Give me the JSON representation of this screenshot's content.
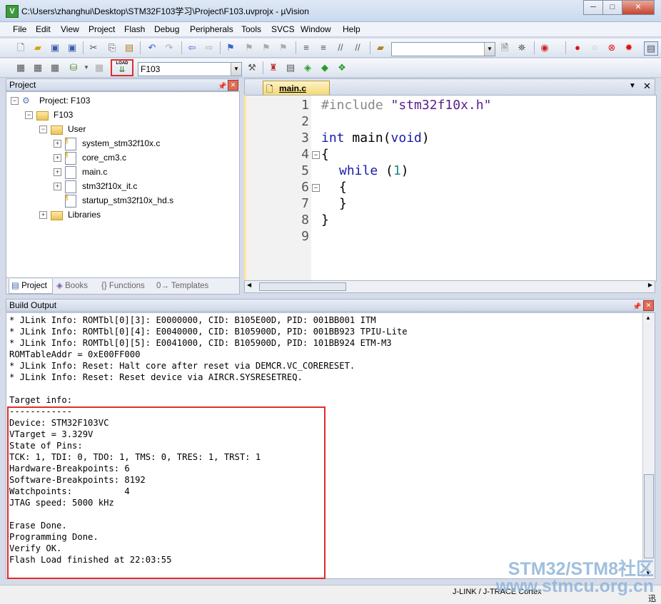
{
  "window": {
    "title": "C:\\Users\\zhanghui\\Desktop\\STM32F103学习\\Project\\F103.uvprojx - µVision",
    "icon_letter": "V",
    "min": "─",
    "max": "□",
    "close": "✕"
  },
  "menu": [
    "File",
    "Edit",
    "View",
    "Project",
    "Flash",
    "Debug",
    "Peripherals",
    "Tools",
    "SVCS",
    "Window",
    "Help"
  ],
  "toolbar2": {
    "load_label": "LOAD",
    "target": "F103"
  },
  "project_panel": {
    "title": "Project",
    "tree": [
      {
        "label": "Project: F103"
      },
      {
        "label": "F103"
      },
      {
        "label": "User"
      },
      {
        "label": "system_stm32f10x.c"
      },
      {
        "label": "core_cm3.c"
      },
      {
        "label": "main.c"
      },
      {
        "label": "stm32f10x_it.c"
      },
      {
        "label": "startup_stm32f10x_hd.s"
      },
      {
        "label": "Libraries"
      }
    ],
    "tabs": [
      "Project",
      "Books",
      "{} Functions",
      "0→ Templates"
    ]
  },
  "editor": {
    "tab": "main.c",
    "line_numbers": [
      "1",
      "2",
      "3",
      "4",
      "5",
      "6",
      "7",
      "8",
      "9"
    ],
    "code": {
      "l1_pre": "#include",
      "l1_str": "\"stm32f10x.h\"",
      "l3_kw": "int",
      "l3_mid": " main(",
      "l3_kw2": "void",
      "l3_end": ")",
      "l4": "{",
      "l5_kw": "while",
      "l5_mid": " (",
      "l5_num": "1",
      "l5_end": ")",
      "l6": "{",
      "l7": "}",
      "l8": "}"
    }
  },
  "build_output": {
    "title": "Build Output",
    "lines": [
      "* JLink Info: ROMTbl[0][3]: E0000000, CID: B105E00D, PID: 001BB001 ITM",
      "* JLink Info: ROMTbl[0][4]: E0040000, CID: B105900D, PID: 001BB923 TPIU-Lite",
      "* JLink Info: ROMTbl[0][5]: E0041000, CID: B105900D, PID: 101BB924 ETM-M3",
      "ROMTableAddr = 0xE00FF000",
      "* JLink Info: Reset: Halt core after reset via DEMCR.VC_CORERESET.",
      "* JLink Info: Reset: Reset device via AIRCR.SYSRESETREQ.",
      "",
      "Target info:",
      "------------",
      "Device: STM32F103VC",
      "VTarget = 3.329V",
      "State of Pins:",
      "TCK: 1, TDI: 0, TDO: 1, TMS: 0, TRES: 1, TRST: 1",
      "Hardware-Breakpoints: 6",
      "Software-Breakpoints: 8192",
      "Watchpoints:          4",
      "JTAG speed: 5000 kHz",
      "",
      "Erase Done.",
      "Programming Done.",
      "Verify OK.",
      "Flash Load finished at 22:03:55"
    ]
  },
  "status": {
    "debugger": "J-LINK / J-TRACE Cortex",
    "tray": "迅"
  },
  "watermark": {
    "line1": "STM32/STM8社区",
    "line2": "www.stmcu.org.cn"
  }
}
